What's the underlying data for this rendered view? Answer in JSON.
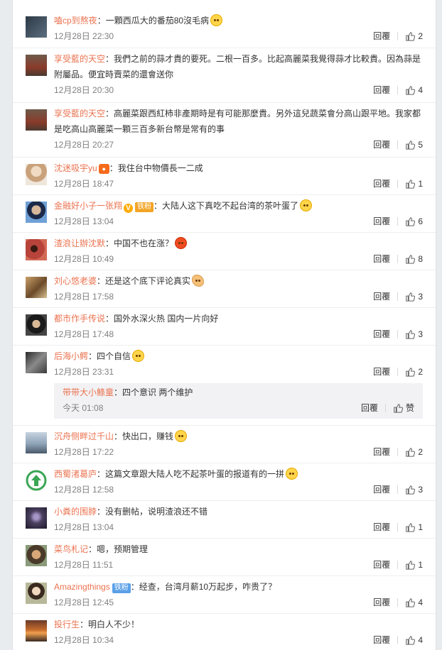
{
  "reply_label": "回覆",
  "colon": "：",
  "comments": [
    {
      "user": "嗑cp到熬夜",
      "text": "一顆西瓜大的番茄80沒毛病",
      "time": "12月28日 22:30",
      "likes": "2",
      "avatar": "#3d4b5a"
    },
    {
      "user": "享受藍的天空",
      "text": "我們之前的蒜才貴的要死。二根一百多。比起高麗菜我覺得蒜才比較貴。因為蒜是附屬品。便宜時賣菜的還會送你",
      "time": "12月28日 20:30",
      "likes": "4",
      "avatar": "#7a4a3a"
    },
    {
      "user": "享受藍的天空",
      "text": "高麗菜跟西紅柿非產期時是有可能那麼貴。另外這兒蔬菜會分高山跟平地。我家都是吃高山高麗菜一顆三百多新台幣是常有的事",
      "time": "12月28日 20:27",
      "likes": "5",
      "avatar": "#7a4a3a"
    },
    {
      "user": "沈迷吸宇yu",
      "text": "我住台中物價長一二成",
      "time": "12月28日 18:47",
      "likes": "1",
      "avatar": "#d9c6a8"
    },
    {
      "user": "金融好小子一张翔",
      "text": "大陆人这下真吃不起台湾的茶叶蛋了",
      "time": "12月28日 13:04",
      "likes": "6",
      "avatar": "#4a5f8a",
      "fan_label": "铁粉"
    },
    {
      "user": "渣浪让辦沈默",
      "text": "中国不也在涨？",
      "time": "12月28日 10:49",
      "likes": "8",
      "avatar": "#b8433a"
    },
    {
      "user": "刘心悠老婆",
      "text": "还是这个底下评论真实",
      "time": "12月28日 17:58",
      "likes": "3",
      "avatar": "#a07b4b"
    },
    {
      "user": "都市作手传说",
      "text": "国外水深火热 国内一片向好",
      "time": "12月28日 17:48",
      "likes": "3",
      "avatar": "#2e2e2e"
    },
    {
      "user": "后海小鳄",
      "text": "四个自信",
      "time": "12月28日 23:31",
      "likes": "2",
      "avatar": "#555555",
      "sub": {
        "user": "带带大小鲦童",
        "text": "四个意识 两个维护",
        "time": "今天 01:08",
        "likes": "赞"
      }
    },
    {
      "user": "沉舟侧畔过千山",
      "text": "快出口，赚钱",
      "time": "12月28日 17:22",
      "likes": "2",
      "avatar": "#8ea3b8"
    },
    {
      "user": "西蜀渚葛庐",
      "text": "这篇文章跟大陆人吃不起茶叶蛋的报道有的一拼",
      "time": "12月28日 12:58",
      "likes": "3",
      "avatar": "#3aa655"
    },
    {
      "user": "小粪的围脖",
      "text": "没有删帖，说明渣浪还不错",
      "time": "12月28日 13:04",
      "likes": "1",
      "avatar": "#4b4060"
    },
    {
      "user": "菜鸟札记",
      "text": "嗯，预期管理",
      "time": "12月28日 11:51",
      "likes": "1",
      "avatar": "#7a5a3a"
    },
    {
      "user": "Amazingthings",
      "text": "经查，台湾月薪10万起步，咋贵了？",
      "time": "12月28日 12:45",
      "likes": "4",
      "avatar": "#9aa07a",
      "fan_label": "铁粉"
    },
    {
      "user": "投行生",
      "text": "明白人不少！",
      "time": "12月28日 10:34",
      "likes": "4",
      "avatar": "#c46a2a"
    }
  ]
}
